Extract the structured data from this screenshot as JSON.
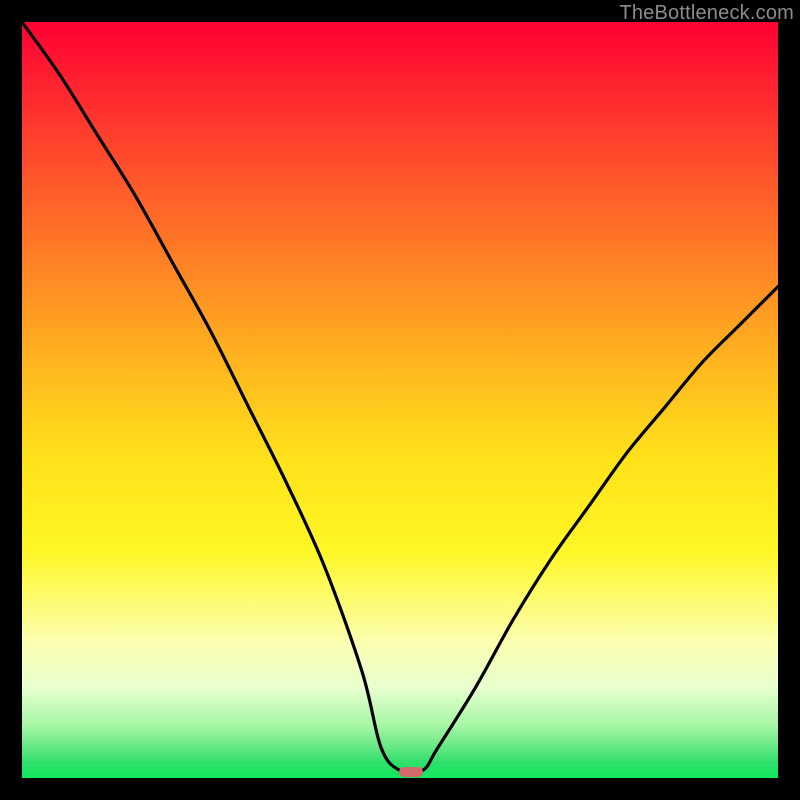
{
  "watermark": "TheBottleneck.com",
  "colors": {
    "frame": "#000000",
    "curve": "#000000",
    "marker": "#d46a6a",
    "watermark": "#8c8c8c"
  },
  "chart_data": {
    "type": "line",
    "title": "",
    "xlabel": "",
    "ylabel": "",
    "xlim": [
      0,
      100
    ],
    "ylim": [
      0,
      100
    ],
    "series": [
      {
        "name": "bottleneck-curve",
        "x": [
          0,
          5,
          10,
          15,
          20,
          25,
          30,
          35,
          40,
          45,
          47.5,
          50,
          53,
          55,
          60,
          65,
          70,
          75,
          80,
          85,
          90,
          95,
          100
        ],
        "values": [
          100,
          93,
          85,
          77,
          68,
          59,
          49,
          39,
          28,
          14,
          4,
          1,
          1,
          4,
          12,
          21,
          29,
          36,
          43,
          49,
          55,
          60,
          65
        ]
      }
    ],
    "marker": {
      "x": 51.5,
      "y": 0.8,
      "w_pct": 3.2,
      "h_pct": 1.4
    },
    "note": "Values are estimated from pixel positions; chart has no axis ticks or labels."
  }
}
